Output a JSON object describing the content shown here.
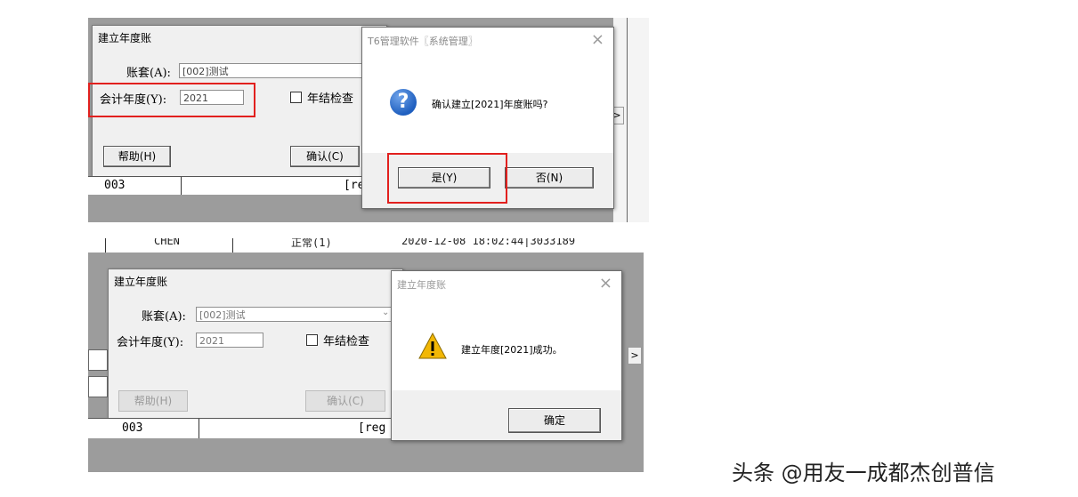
{
  "top": {
    "dialog": {
      "title": "建立年度账",
      "account_label": "账套(A):",
      "account_value": "[002]测试",
      "year_label": "会计年度(Y):",
      "year_value": "2021",
      "year_check_label": "年结检查",
      "help_button": "帮助(H)",
      "confirm_button": "确认(C)"
    },
    "background_row": {
      "col1": "003",
      "col2": "[re"
    },
    "message": {
      "title": "T6管理软件〖系统管理〗",
      "text": "确认建立[2021]年度账吗?",
      "yes_button": "是(Y)",
      "no_button": "否(N)",
      "icon": "question-icon"
    },
    "scroll_arrow": ">"
  },
  "bottom": {
    "header_strip": {
      "user": "CHEN",
      "status": "正常(1)",
      "datetime": "2020-12-08 18:02:44|3033189"
    },
    "dialog": {
      "title": "建立年度账",
      "account_label": "账套(A):",
      "account_value": "[002]测试",
      "year_label": "会计年度(Y):",
      "year_value": "2021",
      "year_check_label": "年结检查",
      "help_button": "帮助(H)",
      "confirm_button": "确认(C)"
    },
    "background_row": {
      "col1": "003",
      "col2": "[reg"
    },
    "message": {
      "title": "建立年度账",
      "text": "建立年度[2021]成功。",
      "ok_button": "确定",
      "icon": "warning-icon"
    },
    "scroll_arrow": ">"
  },
  "watermark": "头条 @用友一成都杰创普信",
  "colors": {
    "highlight": "#e2201e",
    "question_icon": "#1f5fbf",
    "warning_icon": "#f2b705"
  }
}
